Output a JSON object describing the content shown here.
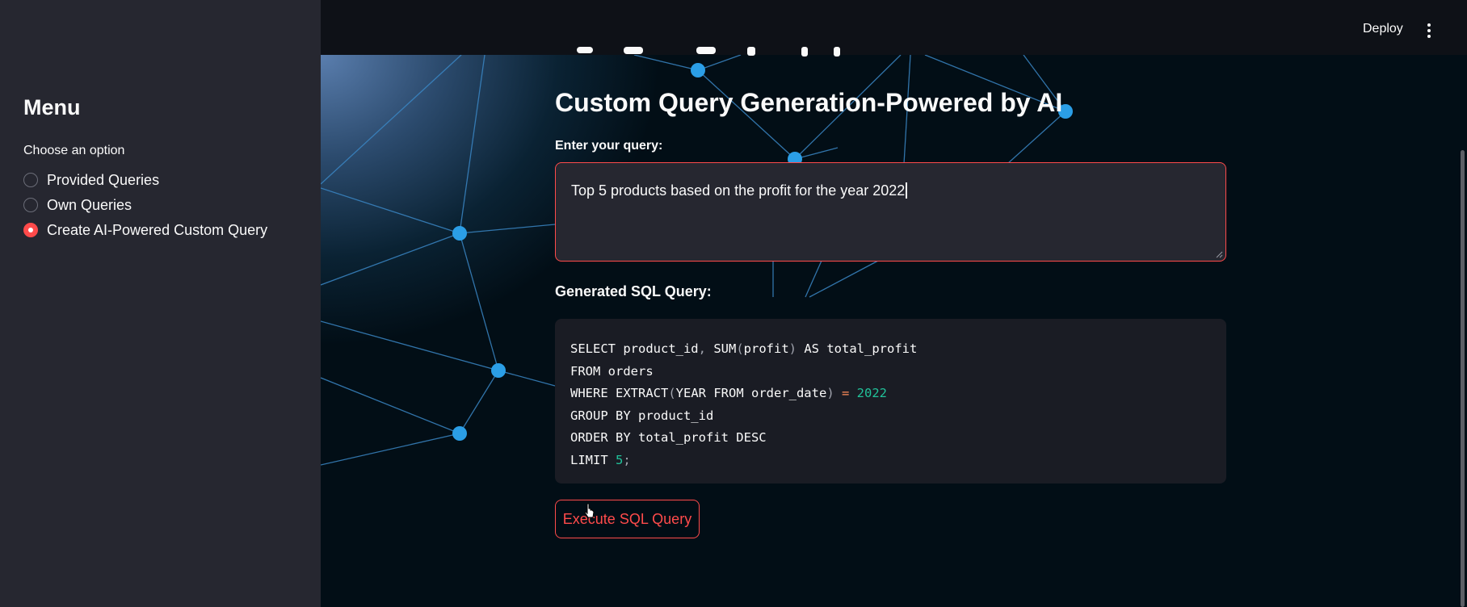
{
  "sidebar": {
    "title": "Menu",
    "choose_label": "Choose an option",
    "options": [
      {
        "label": "Provided Queries",
        "selected": false
      },
      {
        "label": "Own Queries",
        "selected": false
      },
      {
        "label": "Create AI-Powered Custom Query",
        "selected": true
      }
    ]
  },
  "header": {
    "deploy_label": "Deploy",
    "menu_icon": "kebab-menu-icon"
  },
  "main": {
    "section_title": "Custom Query Generation-Powered by AI",
    "query_label": "Enter your query:",
    "query_value": "Top 5 products based on the profit for the year 2022",
    "sql_label": "Generated SQL Query:",
    "sql_lines": [
      "SELECT product_id, SUM(profit) AS total_profit",
      "FROM orders",
      "WHERE EXTRACT(YEAR FROM order_date) = 2022",
      "GROUP BY product_id",
      "ORDER BY total_profit DESC",
      "LIMIT 5;"
    ],
    "execute_button": "Execute SQL Query"
  },
  "colors": {
    "accent": "#ff4b4b",
    "sidebar_bg": "#262730",
    "header_bg": "#0e1117",
    "node": "#2b9ee6"
  }
}
